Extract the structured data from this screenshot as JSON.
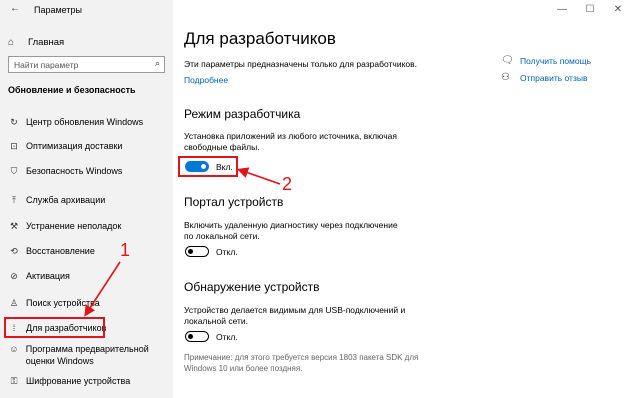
{
  "window": {
    "title": "Параметры",
    "back_icon": "back-arrow-icon",
    "minimize": "—",
    "maximize": "☐",
    "close": "✕"
  },
  "sidebar": {
    "home": {
      "label": "Главная",
      "icon": "home-icon"
    },
    "search": {
      "placeholder": "Найти параметр",
      "icon": "search-icon"
    },
    "section_title": "Обновление и безопасность",
    "items": [
      {
        "label": "Центр обновления Windows",
        "icon": "refresh-icon"
      },
      {
        "label": "Оптимизация доставки",
        "icon": "delivery-icon"
      },
      {
        "label": "Безопасность Windows",
        "icon": "shield-icon"
      },
      {
        "label": "Служба архивации",
        "icon": "backup-icon"
      },
      {
        "label": "Устранение неполадок",
        "icon": "wrench-icon"
      },
      {
        "label": "Восстановление",
        "icon": "recovery-icon"
      },
      {
        "label": "Активация",
        "icon": "activation-icon"
      },
      {
        "label": "Поиск устройства",
        "icon": "person-icon"
      },
      {
        "label": "Для разработчиков",
        "icon": "developer-icon"
      },
      {
        "label": "Программа предварительной оценки Windows",
        "icon": "insider-icon"
      },
      {
        "label": "Шифрование устройства",
        "icon": "encryption-icon"
      }
    ]
  },
  "main": {
    "title": "Для разработчиков",
    "intro": "Эти параметры предназначены только для разработчиков.",
    "intro_link": "Подробнее",
    "help": {
      "get_help": "Получить помощь",
      "feedback": "Отправить отзыв"
    },
    "sections": [
      {
        "title": "Режим разработчика",
        "description": "Установка приложений из любого источника, включая свободные файлы.",
        "toggle_state": "on",
        "toggle_label": "Вкл."
      },
      {
        "title": "Портал устройств",
        "description": "Включить удаленную диагностику через подключение по локальной сети.",
        "toggle_state": "off",
        "toggle_label": "Откл."
      },
      {
        "title": "Обнаружение устройств",
        "description": "Устройство делается видимым для USB-подключений и локальной сети.",
        "toggle_state": "off",
        "toggle_label": "Откл."
      }
    ],
    "note": "Примечание: для этого требуется версия 1803 пакета SDK для Windows 10 или более поздняя."
  },
  "annotations": {
    "marker_1": "1",
    "marker_2": "2",
    "color": "#e1141c"
  },
  "colors": {
    "accent": "#0078d7",
    "link": "#0063b1",
    "sidebar_bg": "#f2f2f2"
  }
}
